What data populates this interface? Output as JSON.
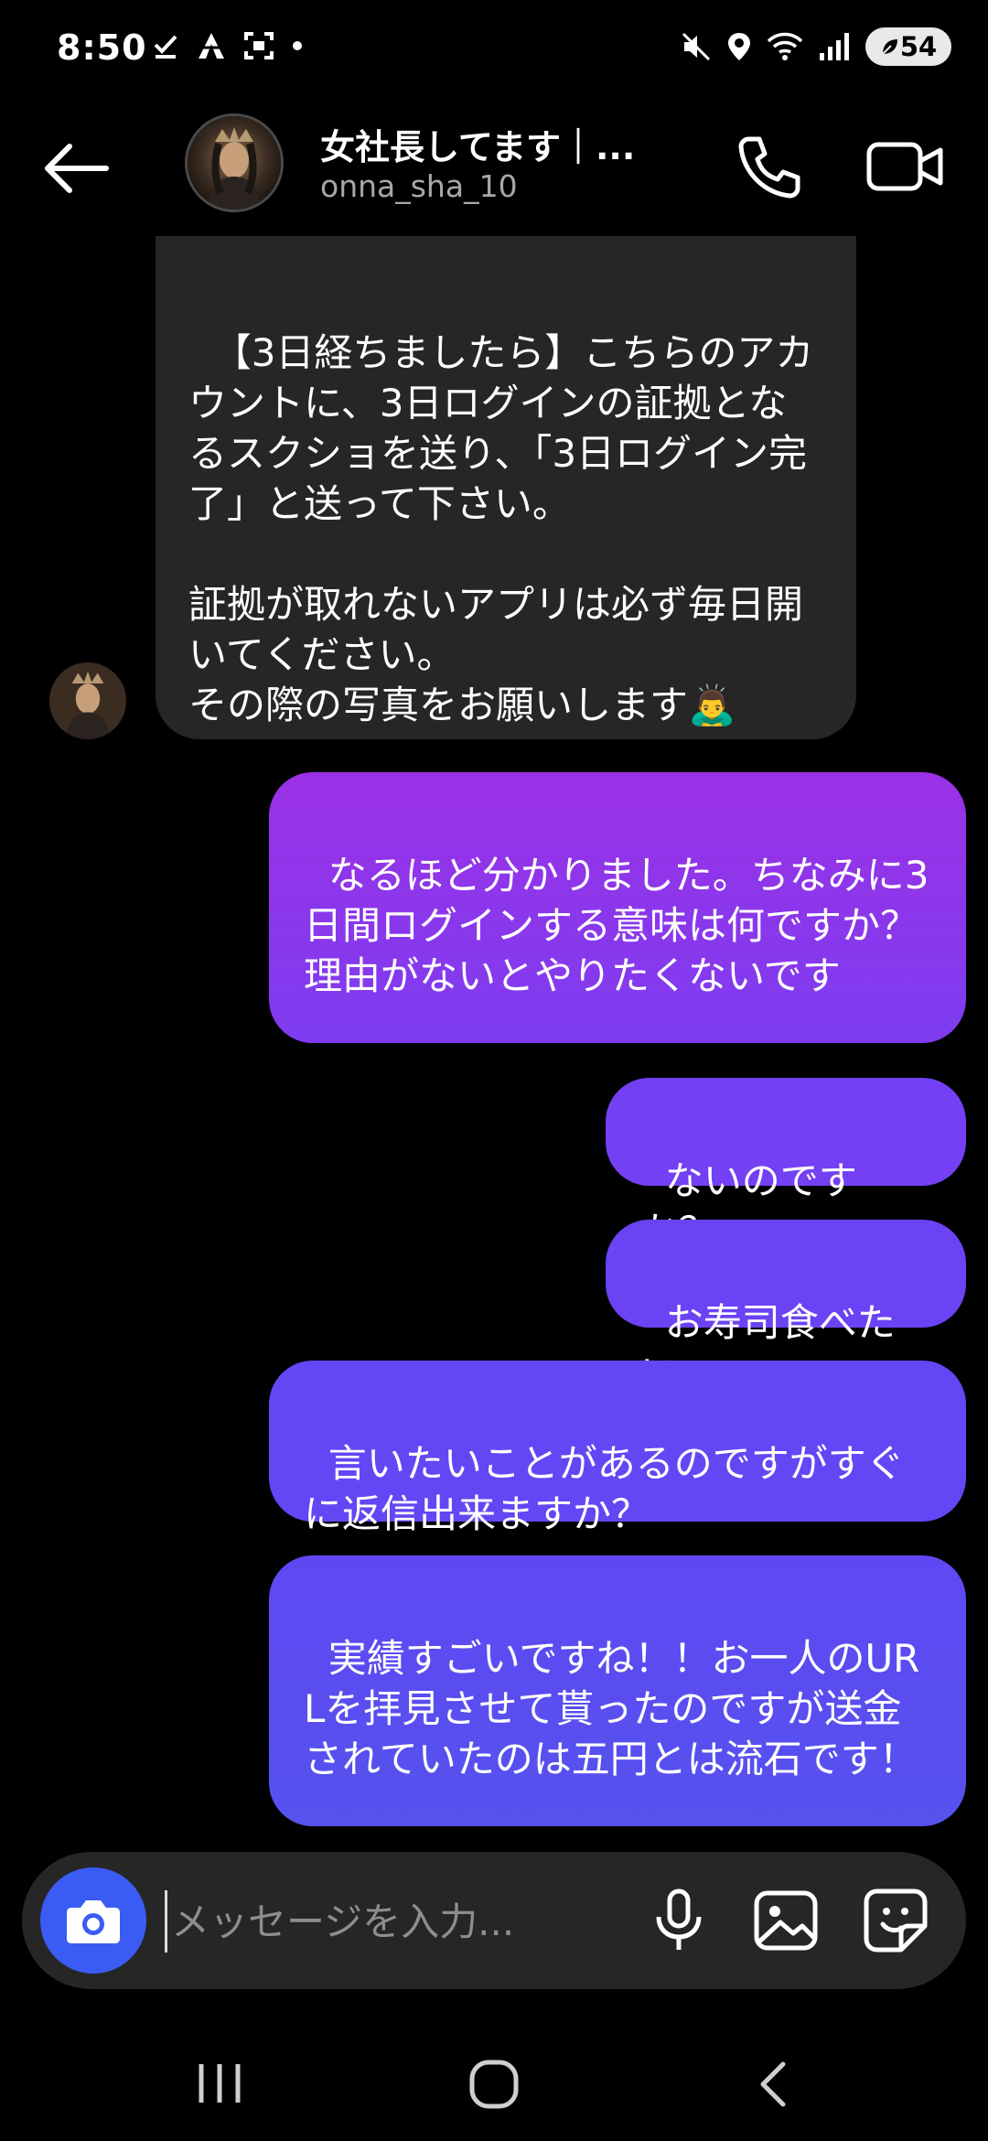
{
  "status_bar": {
    "time": "8:50",
    "battery": "54",
    "left_icons": [
      "check-icon",
      "tent-icon",
      "screenshot-icon",
      "dot-icon"
    ],
    "right_icons": [
      "mute-icon",
      "location-icon",
      "wifi-icon",
      "signal-icon"
    ]
  },
  "header": {
    "name": "女社長してます｜...",
    "username": "onna_sha_10"
  },
  "messages": {
    "incoming": [
      {
        "text": "【3日経ちましたら】こちらのアカウントに、3日ログインの証拠となるスクショを送り、「3日ログイン完了」と送って下さい。\n\n証拠が取れないアプリは必ず毎日開いてください。\nその際の写真をお願いします🙇‍♂️"
      }
    ],
    "outgoing": [
      {
        "text": "なるほど分かりました。ちなみに3日間ログインする意味は何ですか？理由がないとやりたくないです"
      },
      {
        "text": "ないのですか？"
      },
      {
        "text": "お寿司食べたい"
      },
      {
        "text": "言いたいことがあるのですがすぐに返信出来ますか？"
      },
      {
        "text": "実績すごいですね！！お一人のURLを拝見させて貰ったのですが送金されていたのは五円とは流石です！"
      }
    ]
  },
  "composer": {
    "placeholder": "メッセージを入力..."
  },
  "colors": {
    "background": "#000000",
    "incoming_bubble": "#262626",
    "outgoing_gradient_top": "#9a31e6",
    "outgoing_gradient_bottom": "#5552ee",
    "camera_button": "#3a5cf4",
    "username_text": "#a8a8a8"
  }
}
